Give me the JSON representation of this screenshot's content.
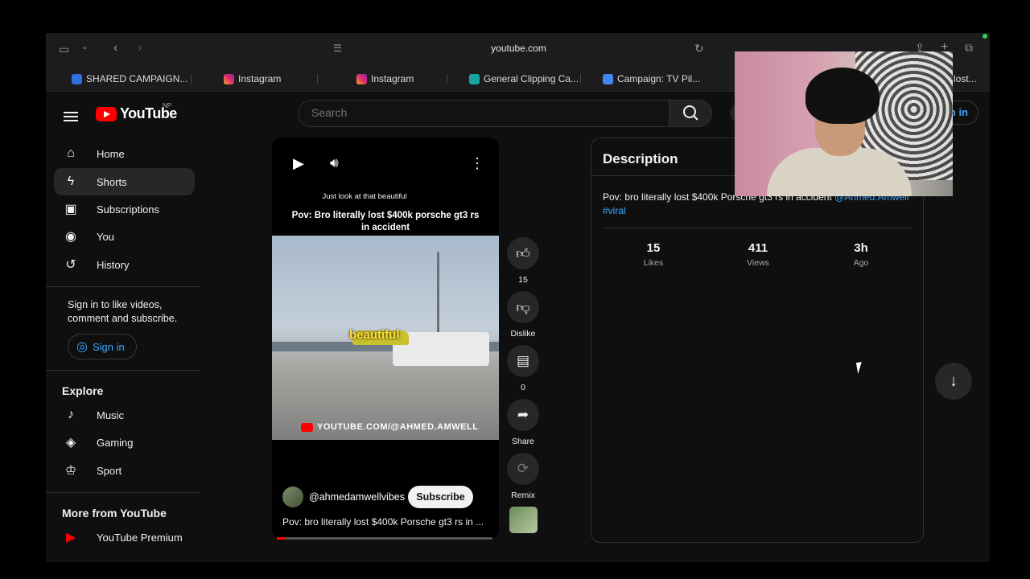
{
  "browser": {
    "url": "youtube.com",
    "tabs": [
      {
        "label": "SHARED CAMPAIGN...",
        "icon": "doc-icon",
        "color": "#2f6fe0"
      },
      {
        "label": "Instagram",
        "icon": "instagram-icon",
        "color": "#e1306c"
      },
      {
        "label": "Instagram",
        "icon": "instagram-icon",
        "color": "#e1306c"
      },
      {
        "label": "General Clipping Ca...",
        "icon": "clipping-icon",
        "color": "#1aa3a3"
      },
      {
        "label": "Campaign: TV Pil...",
        "icon": "docs-icon",
        "color": "#4285f4"
      },
      {
        "label": "lost...",
        "icon": "page-icon",
        "color": "#888888"
      }
    ]
  },
  "header": {
    "logo_text": "YouTube",
    "region": "NP",
    "search_placeholder": "Search",
    "sign_in": "n in"
  },
  "sidebar": {
    "items": [
      {
        "label": "Home",
        "icon": "home-icon"
      },
      {
        "label": "Shorts",
        "icon": "shorts-icon"
      },
      {
        "label": "Subscriptions",
        "icon": "subscriptions-icon"
      },
      {
        "label": "You",
        "icon": "you-icon"
      },
      {
        "label": "History",
        "icon": "history-icon"
      }
    ],
    "signin_prompt": "Sign in to like videos, comment and subscribe.",
    "signin_button": "Sign in",
    "explore_title": "Explore",
    "explore": [
      {
        "label": "Music",
        "icon": "music-icon"
      },
      {
        "label": "Gaming",
        "icon": "gaming-icon"
      },
      {
        "label": "Sport",
        "icon": "sport-icon"
      }
    ],
    "more_title": "More from YouTube",
    "more": [
      {
        "label": "YouTube Premium",
        "icon": "youtube-premium-icon"
      }
    ]
  },
  "short": {
    "caption_small": "Just look at that beautiful",
    "title": "Pov: Bro literally lost $400k porsche gt3 rs in accident",
    "overlay_word": "beautiful",
    "watermark": "YOUTUBE.COM/@AHMED.AMWELL",
    "channel": "@ahmedamwellvibes",
    "subscribe": "Subscribe",
    "description": "Pov: bro literally lost $400k Porsche gt3 rs in ...",
    "progress": 0.04
  },
  "actions": {
    "likes": "15",
    "dislike": "Dislike",
    "comments": "0",
    "share": "Share",
    "remix": "Remix"
  },
  "description_panel": {
    "title": "Description",
    "text": "Pov: bro literally lost $400k Porsche gt3 rs in accident ",
    "mention": "@Ahmed.Amwell",
    "hashtag": "#viral",
    "stats": [
      {
        "value": "15",
        "label": "Likes"
      },
      {
        "value": "411",
        "label": "Views"
      },
      {
        "value": "3h",
        "label": "Ago"
      }
    ]
  }
}
